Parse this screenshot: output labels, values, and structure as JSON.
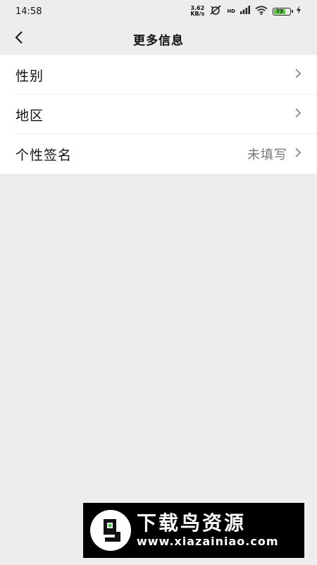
{
  "status_bar": {
    "time": "14:58",
    "net_speed_value": "3.62",
    "net_speed_unit": "KB/s",
    "hd_label": "HD",
    "battery_level": "73"
  },
  "nav": {
    "title": "更多信息"
  },
  "list": {
    "items": [
      {
        "label": "性别",
        "value": ""
      },
      {
        "label": "地区",
        "value": ""
      },
      {
        "label": "个性签名",
        "value": "未填写"
      }
    ]
  },
  "watermark": {
    "title": "下载鸟资源",
    "url": "www.xiazainiao.com"
  },
  "colors": {
    "background": "#ededed",
    "card": "#ffffff",
    "battery": "#57c73a"
  }
}
